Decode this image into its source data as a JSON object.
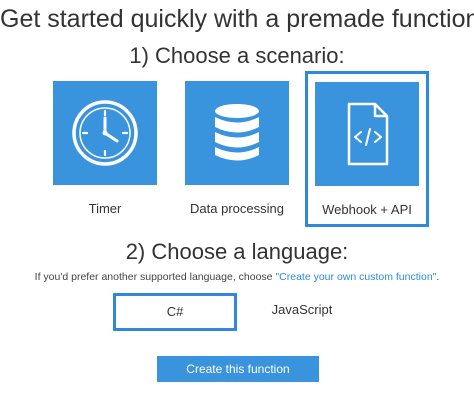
{
  "header": {
    "title": "Get started quickly with a premade function"
  },
  "scenario": {
    "heading": "1) Choose a scenario:",
    "selected": "Webhook + API",
    "tiles": [
      {
        "label": "Timer",
        "icon": "clock-icon"
      },
      {
        "label": "Data processing",
        "icon": "database-icon"
      },
      {
        "label": "Webhook + API",
        "icon": "code-file-icon"
      }
    ]
  },
  "language": {
    "heading": "2) Choose a language:",
    "helper_prefix": "If you'd prefer another supported language, choose ",
    "helper_link": "\"Create your own custom function\"",
    "helper_suffix": ".",
    "selected": "C#",
    "options": [
      {
        "label": "C#"
      },
      {
        "label": "JavaScript"
      }
    ]
  },
  "actions": {
    "create_label": "Create this function"
  },
  "colors": {
    "accent": "#3a93dd",
    "selection_border": "#2e8ad8",
    "link": "#2e8ad8"
  }
}
